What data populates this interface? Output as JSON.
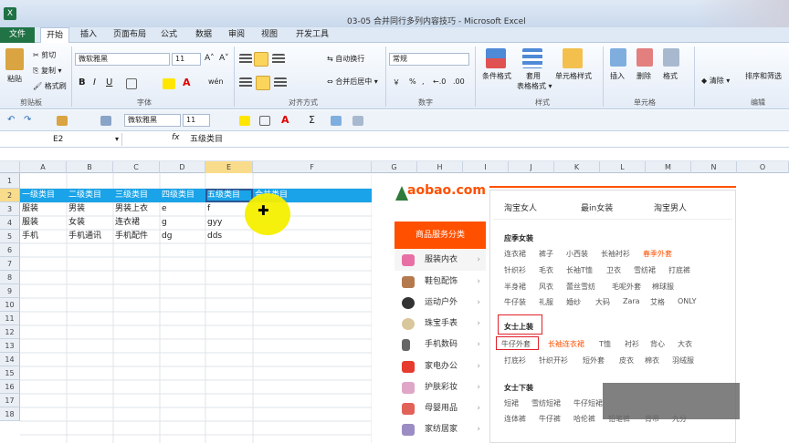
{
  "window": {
    "title": "03-05 合并同行多列内容技巧 - Microsoft Excel",
    "logo": "X"
  },
  "tabs": [
    "文件",
    "开始",
    "插入",
    "页面布局",
    "公式",
    "数据",
    "审阅",
    "视图",
    "开发工具"
  ],
  "ribbon": {
    "clipboard": {
      "cut": "剪切",
      "copy": "复制 ▾",
      "format_painter": "格式刷",
      "paste": "粘贴",
      "group": "剪贴板"
    },
    "font": {
      "name": "微软雅黑",
      "size": "11",
      "group": "字体",
      "bold": "B",
      "italic": "I",
      "underline": "U",
      "grow": "A˄",
      "shrink": "A˅",
      "fontcolor": "A",
      "wen": "wén"
    },
    "alignment": {
      "wrap": "自动换行",
      "merge": "合并后居中 ▾",
      "group": "对齐方式"
    },
    "number": {
      "format": "常规",
      "percent": "%",
      "comma": ",",
      "dec_inc": "←.0",
      "dec_dec": ".00",
      "currency": "￥",
      "group": "数字"
    },
    "styles": {
      "cond": "条件格式",
      "table": "套用",
      "table2": "表格格式 ▾",
      "cell": "单元格样式",
      "group": "样式"
    },
    "cells": {
      "insert": "插入",
      "delete": "删除",
      "format": "格式",
      "group": "单元格"
    },
    "editing": {
      "clear": "清除 ▾",
      "sort": "排序和筛选",
      "group": "编辑"
    }
  },
  "qat": {
    "font": "微软雅黑",
    "size": "11",
    "sigma": "Σ"
  },
  "formula": {
    "namebox": "E2",
    "fx": "fx",
    "content": "五级类目"
  },
  "columns": [
    "A",
    "B",
    "C",
    "D",
    "E",
    "F",
    "G",
    "H",
    "I",
    "J",
    "K",
    "L",
    "M",
    "N",
    "O"
  ],
  "rows": [
    "1",
    "2",
    "3",
    "4",
    "5",
    "6",
    "7",
    "8",
    "9",
    "10",
    "11",
    "12",
    "13",
    "14",
    "15",
    "16",
    "17",
    "18"
  ],
  "cells": {
    "r2": [
      "一级类目",
      "二级类目",
      "三级类目",
      "四级类目",
      "五级类目",
      "合并类目"
    ],
    "r3": [
      "服装",
      "男装",
      "男装上衣",
      "e",
      "f"
    ],
    "r4": [
      "服装",
      "女装",
      "连衣裙",
      "g",
      "gyy"
    ],
    "r5": [
      "手机",
      "手机通讯",
      "手机配件",
      "dg",
      "dds"
    ]
  },
  "taobao": {
    "logo": "aobao.com",
    "side_title": "商品服务分类",
    "side": [
      "服装内衣",
      "鞋包配饰",
      "运动户外",
      "珠宝手表",
      "手机数码",
      "家电办公",
      "护肤彩妆",
      "母婴用品",
      "家纺居家"
    ],
    "top_tabs": [
      "淘宝女人",
      "最in女装",
      "淘宝男人"
    ],
    "s1_title": "应季女装",
    "s1": [
      [
        "连衣裙",
        "裤子",
        "小西装",
        "长袖衬衫",
        "春季外套"
      ],
      [
        "针织衫",
        "毛衣",
        "长袖T恤",
        "卫衣",
        "雪纺裙",
        "打底裤"
      ],
      [
        "半身裙",
        "风衣",
        "蕾丝雪纺",
        "毛呢外套",
        "棉球服"
      ],
      [
        "牛仔装",
        "礼服",
        "婚纱",
        "大码",
        "Zara",
        "艾格",
        "ONLY"
      ]
    ],
    "s2_title": "女士上装",
    "s2": [
      [
        "牛仔外套",
        "长袖连衣裙",
        "T恤",
        "衬衫",
        "背心",
        "大衣"
      ],
      [
        "打底衫",
        "针织开衫",
        "短外套",
        "皮衣",
        "棉衣",
        "羽绒服"
      ]
    ],
    "s3_title": "女士下装",
    "s3": [
      [
        "短裙",
        "雪纺短裙",
        "牛仔短裙"
      ],
      [
        "连体裤",
        "牛仔裤",
        "哈伦裤",
        "铅笔裤",
        "背带",
        "九分"
      ]
    ]
  }
}
